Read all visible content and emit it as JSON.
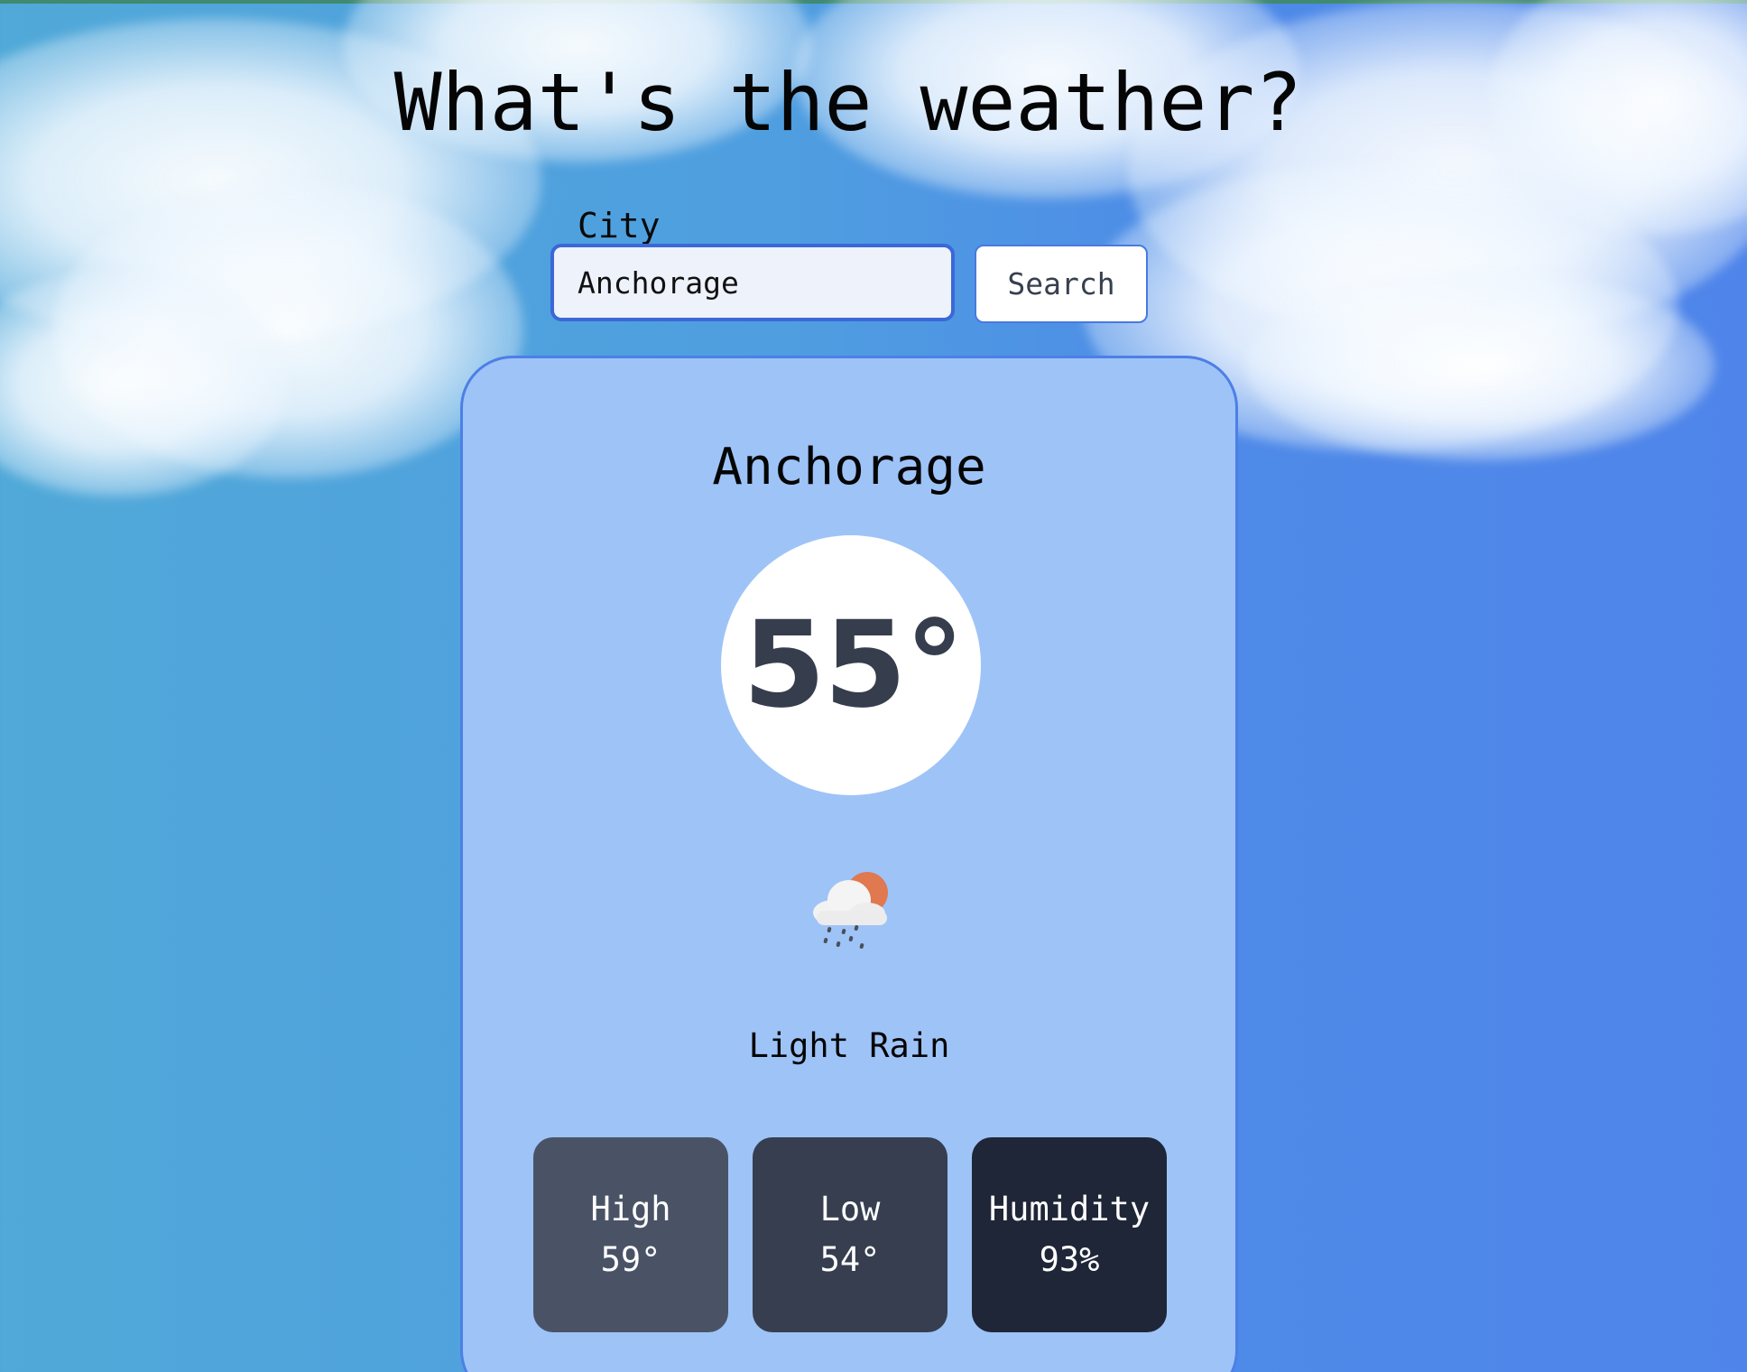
{
  "header": {
    "title": "What's the weather?"
  },
  "search": {
    "label": "City",
    "value": "Anchorage",
    "button_label": "Search"
  },
  "weather": {
    "city": "Anchorage",
    "temperature": "55°",
    "icon": "cloud-sun-rain-icon",
    "condition": "Light Rain",
    "stats": {
      "high_label": "High",
      "high_value": "59°",
      "low_label": "Low",
      "low_value": "54°",
      "humidity_label": "Humidity",
      "humidity_value": "93%"
    }
  },
  "colors": {
    "card_background": "#9ec3f7",
    "card_border": "#4d7fe6",
    "input_border": "#3b68d8",
    "high_box": "#4a5366",
    "low_box": "#363e50",
    "humidity_box": "#1f2637",
    "temperature_text": "#363d4c"
  }
}
